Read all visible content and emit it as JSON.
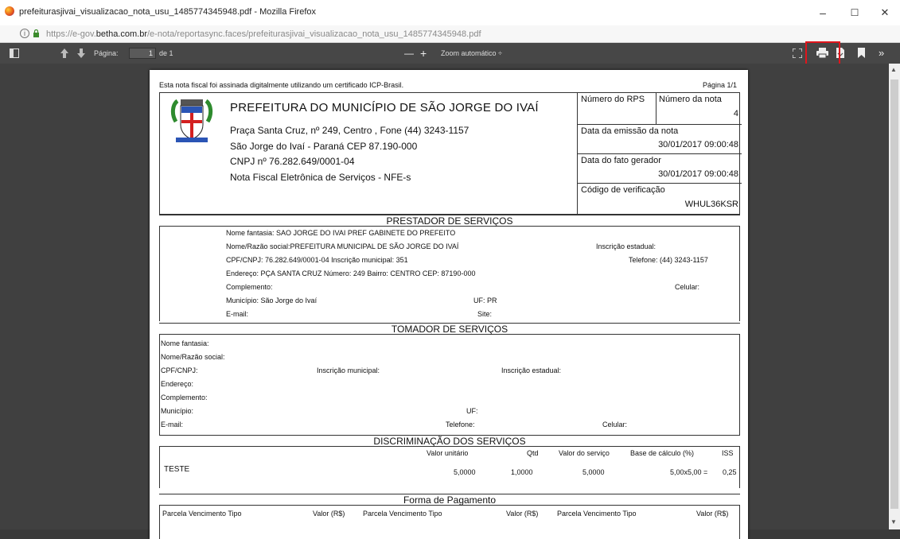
{
  "window": {
    "title": "prefeiturasjivai_visualizacao_nota_usu_1485774345948.pdf - Mozilla Firefox",
    "minimize": "–",
    "maximize": "☐",
    "close": "✕"
  },
  "urlbar": {
    "prefix": "https://e-gov.",
    "domain": "betha.com.br",
    "path": "/e-nota/reportasync.faces/prefeiturasjivai_visualizacao_nota_usu_1485774345948.pdf"
  },
  "pdf_toolbar": {
    "page_label": "Página:",
    "page_value": "1",
    "page_total": "de 1",
    "zoom_minus": "—",
    "zoom_plus": "+",
    "zoom_value": "Zoom automático  ÷"
  },
  "doc": {
    "signed_note": "Esta nota fiscal foi assinada digitalmente utilizando um certificado ICP-Brasil.",
    "page": "Página 1/1",
    "header": {
      "title": "PREFEITURA DO MUNICÍPIO DE SÃO JORGE DO IVAÍ",
      "address": "Praça Santa Cruz, nº 249, Centro , Fone (44) 3243-1157",
      "city": "São Jorge do Ivaí - Paraná  CEP 87.190-000",
      "cnpj": "CNPJ nº 76.282.649/0001-04",
      "type": "Nota Fiscal Eletrônica de Serviços - NFE-s"
    },
    "right": {
      "rps_label": "Número do RPS",
      "nota_label": "Número da nota",
      "nota_value": "4",
      "emissao_label": "Data da emissão da nota",
      "emissao_value": "30/01/2017 09:00:48",
      "fato_label": "Data do fato gerador",
      "fato_value": "30/01/2017 09:00:48",
      "codigo_label": "Código de verificação",
      "codigo_value": "WHUL36KSR"
    },
    "prestador": {
      "title": "PRESTADOR DE SERVIÇOS",
      "fantasia": "Nome fantasia: SAO JORGE DO IVAI PREF GABINETE DO PREFEITO",
      "razao": "Nome/Razão social:PREFEITURA MUNICIPAL DE SÃO JORGE DO IVAÍ",
      "insc_estadual": "Inscrição estadual:",
      "cpf": "CPF/CNPJ: 76.282.649/0001-04     Inscrição municipal: 351",
      "telefone": "Telefone: (44) 3243-1157",
      "endereco": "Endereço: PÇA SANTA CRUZ Número: 249 Bairro: CENTRO CEP: 87190-000",
      "complemento": "Complemento:",
      "celular": "Celular:",
      "municipio": "Município:  São Jorge do Ivaí",
      "uf": "UF: PR",
      "email": "E-mail:",
      "site": "Site:"
    },
    "tomador": {
      "title": "TOMADOR DE SERVIÇOS",
      "fantasia": "Nome fantasia:",
      "razao": "Nome/Razão social:",
      "cpf": "CPF/CNPJ:",
      "insc_municipal": "Inscrição municipal:",
      "insc_estadual": "Inscrição estadual:",
      "endereco": "Endereço:",
      "complemento": "Complemento:",
      "municipio": "Município:",
      "uf": "UF:",
      "email": "E-mail:",
      "telefone": "Telefone:",
      "celular": "Celular:"
    },
    "servicos": {
      "title": "DISCRIMINAÇÃO DOS SERVIÇOS",
      "h_unit": "Valor unitário",
      "h_qtd": "Qtd",
      "h_valor": "Valor do serviço",
      "h_base": "Base de cálculo  (%)",
      "h_iss": "ISS",
      "desc": "TESTE",
      "unit": "5,0000",
      "qtd": "1,0000",
      "valor": "5,0000",
      "base": "5,00x5,00 =",
      "iss": "0,25"
    },
    "pagamento": {
      "title": "Forma de Pagamento",
      "h1": "Parcela  Vencimento  Tipo",
      "v1": "Valor (R$)",
      "h2": "Parcela  Vencimento  Tipo",
      "v2": "Valor (R$)",
      "h3": "Parcela  Vencimento  Tipo",
      "v3": "Valor (R$)"
    }
  }
}
